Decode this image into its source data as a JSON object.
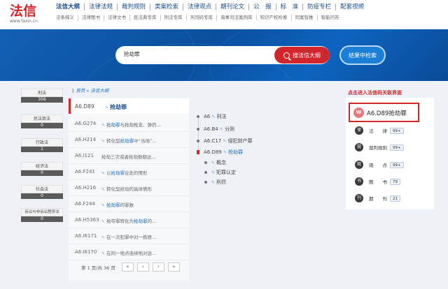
{
  "logo": {
    "text": "法信",
    "domain": "www.faxin.cn"
  },
  "nav_main": [
    "法信大纲",
    "法律法规",
    "裁判规则",
    "类案检索",
    "法律观点",
    "期刊论文",
    "公　报",
    "标　准",
    "防疫专栏",
    "配套视频"
  ],
  "nav_sub": [
    "法条释义",
    "法律图书",
    "法律文书",
    "民法典专库",
    "刑法专库",
    "天同码专库",
    "海事司法案例库",
    "知识产权检索",
    "同案智推",
    "智能问答"
  ],
  "search": {
    "value": "抢劫罪",
    "button": "搜法信大纲",
    "result_button": "结果中检索"
  },
  "categories": [
    {
      "label": "刑法",
      "count": "356"
    },
    {
      "label": "民法商法",
      "count": "0"
    },
    {
      "label": "行政法",
      "count": "1"
    },
    {
      "label": "经济法",
      "count": "0"
    },
    {
      "label": "社会法",
      "count": "0"
    },
    {
      "label": "诉讼与非诉讼程序法",
      "count": "0"
    }
  ],
  "breadcrumb": {
    "home": "首页",
    "current": "法信大纲"
  },
  "list_head": {
    "code": "A6.D89",
    "title": "抢劫罪"
  },
  "list": [
    {
      "code": "A6.G274",
      "hl": "抢劫罪",
      "pre": "",
      "post": "与抢劫枪支、弹药..."
    },
    {
      "code": "A6.H214",
      "hl": "抢劫罪",
      "pre": "转化型",
      "post": "中“当场”..."
    },
    {
      "code": "A6.I121",
      "hl": "",
      "pre": "抢劫三次或者抢劫数额达...",
      "post": ""
    },
    {
      "code": "A6.F241",
      "hl": "抢劫罪",
      "pre": "以",
      "post": "论处的情形"
    },
    {
      "code": "A6.H216",
      "hl": "",
      "pre": "转化型抢劫的具体情形",
      "post": ""
    },
    {
      "code": "A6.F244",
      "hl": "抢劫罪",
      "pre": "",
      "post": "的罪数"
    },
    {
      "code": "A6.H5363",
      "hl": "抢劫罪",
      "pre": "抢夺罪转化为",
      "post": "的..."
    },
    {
      "code": "A6.I6171",
      "hl": "",
      "pre": "在一次犯罪中对一栋居...",
      "post": ""
    },
    {
      "code": "A6.I6170",
      "hl": "",
      "pre": "在同一地点连续地对途...",
      "post": ""
    }
  ],
  "pager": {
    "info": "第 1 页/共 36 页",
    "first": "«",
    "prev": "‹",
    "next": "›",
    "last": "»"
  },
  "tree": [
    {
      "code": "A6",
      "label": "刑法"
    },
    {
      "code": "A6.B4",
      "label": "分则"
    },
    {
      "code": "A6.C17",
      "label": "侵犯财产罪"
    },
    {
      "code": "A6.D89",
      "label": "抢劫罪"
    }
  ],
  "tree_children": [
    "概念",
    "犯罪认定",
    "刑罚"
  ],
  "hint": "点击进入法信码关联界面",
  "key": {
    "badge": "W",
    "text": "A6.D89抢劫罪"
  },
  "related": [
    {
      "icon": "律",
      "label": "法　　律",
      "count": "99+"
    },
    {
      "icon": "规",
      "label": "裁判规则",
      "count": "99+"
    },
    {
      "icon": "观",
      "label": "观　　点",
      "count": "99+"
    },
    {
      "icon": "书",
      "label": "图　　书",
      "count": "79"
    },
    {
      "icon": "刊",
      "label": "期　　刊",
      "count": "21"
    }
  ],
  "colors": {
    "brand_red": "#d0262c",
    "link_blue": "#1a6fc4",
    "banner_blue": "#0a4f9e"
  }
}
